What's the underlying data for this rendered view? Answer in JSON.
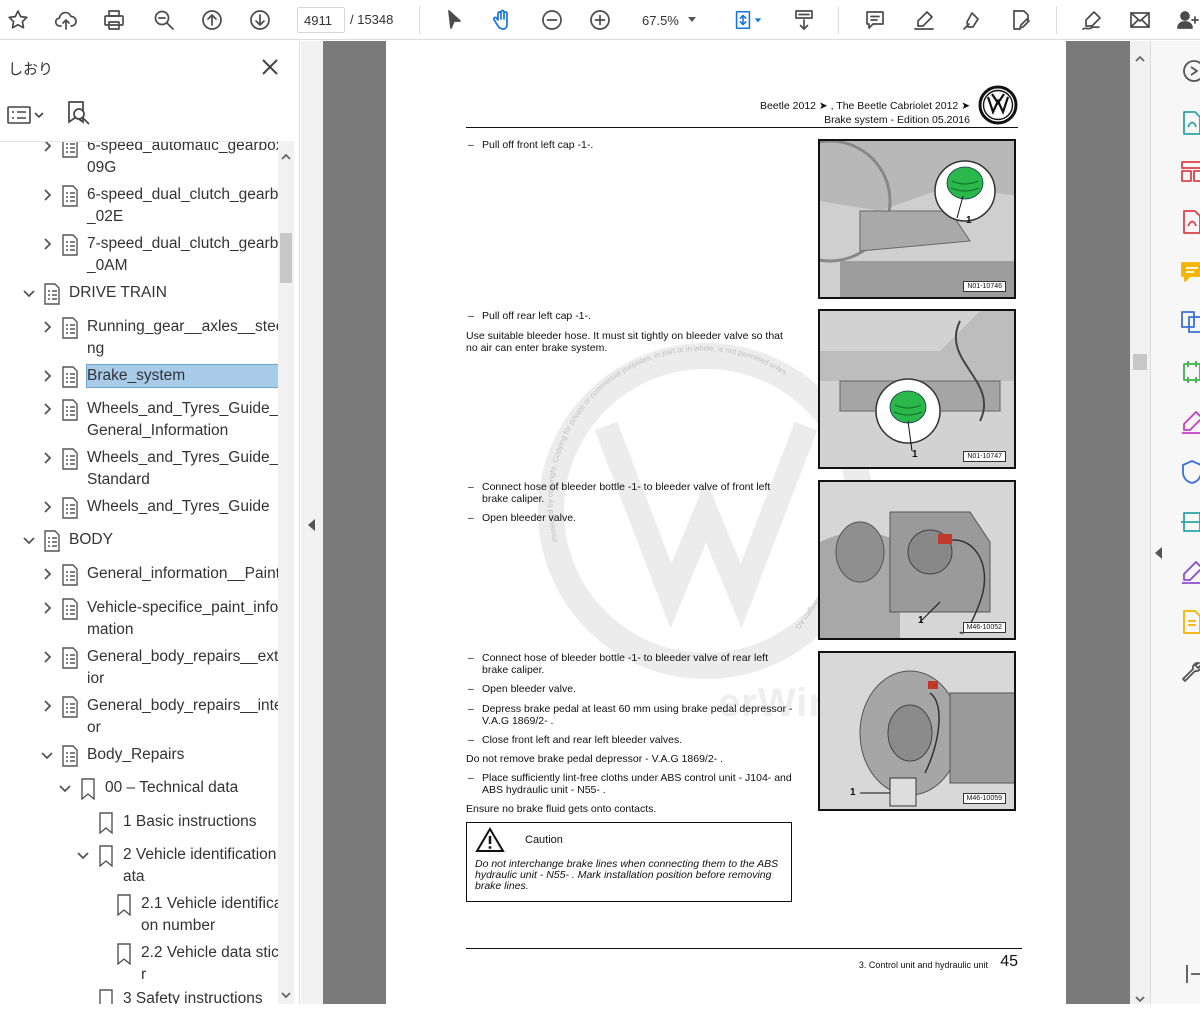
{
  "toolbar": {
    "page_current": "4911",
    "page_total": "/  15348",
    "zoom": "67.5%"
  },
  "bookmarks": {
    "title": "しおり",
    "items": [
      {
        "label": "6-speed_automatic_gearbox_09G"
      },
      {
        "label": "6-speed_dual_clutch_gearbox_02E"
      },
      {
        "label": "7-speed_dual_clutch_gearbox_0AM"
      },
      {
        "label": "DRIVE TRAIN"
      },
      {
        "label": "Running_gear__axles__steering"
      },
      {
        "label": "Brake_system"
      },
      {
        "label": "Wheels_and_Tyres_Guide_-_General_Information"
      },
      {
        "label": "Wheels_and_Tyres_Guide_-_Standard"
      },
      {
        "label": "Wheels_and_Tyres_Guide"
      },
      {
        "label": "BODY"
      },
      {
        "label": "General_information__Paint"
      },
      {
        "label": "Vehicle-specifice_paint_information"
      },
      {
        "label": "General_body_repairs__exterior"
      },
      {
        "label": "General_body_repairs__interior"
      },
      {
        "label": "Body_Repairs"
      },
      {
        "label": "00 – Technical data"
      },
      {
        "label": "1 Basic instructions"
      },
      {
        "label": "2 Vehicle identification data"
      },
      {
        "label": "2.1 Vehicle identification number"
      },
      {
        "label": "2.2 Vehicle data sticker"
      },
      {
        "label": "3 Safety instructions"
      }
    ]
  },
  "page": {
    "header_line1": "Beetle 2012 ➤ , The Beetle Cabriolet 2012 ➤",
    "header_line2": "Brake system - Edition 05.2016",
    "steps": [
      "Pull off front left cap -1-.",
      "Pull off rear left cap -1-.",
      "Use suitable bleeder hose. It must sit tightly on bleeder valve so that no air can enter brake system.",
      "Connect hose of bleeder bottle -1- to bleeder valve of front left brake caliper.",
      "Open bleeder valve.",
      "Connect hose of bleeder bottle -1- to bleeder valve of rear left brake caliper.",
      "Open bleeder valve.",
      "Depress brake pedal at least 60 mm using brake pedal depressor - V.A.G 1869/2- .",
      "Close front left and rear left bleeder valves.",
      "Do not remove brake pedal depressor - V.A.G 1869/2- .",
      "Place sufficiently lint-free cloths under ABS control unit - J104- and ABS hydraulic unit - N55- .",
      "Ensure no brake fluid gets onto contacts."
    ],
    "figures": [
      {
        "code": "N01-10746",
        "callout": "1"
      },
      {
        "code": "N01-10747",
        "callout": "1"
      },
      {
        "code": "M46-10052",
        "callout": "1"
      },
      {
        "code": "M46-10059",
        "callout": "1"
      }
    ],
    "caution_title": "Caution",
    "caution_text": "Do not interchange brake lines when connecting them to the ABS hydraulic unit - N55- . Mark installation position before removing brake lines.",
    "footer_section": "3. Control unit and hydraulic unit",
    "footer_page": "45",
    "watermark_text": "Protected by copyright. Copying for private or commercial purposes, in part or in whole, is not permitted unless authorised by Volkswagen AG. Volkswagen AG does not",
    "watermark_text2": "Copyright by Volkswagen AG",
    "watermark_brand": "erWin"
  },
  "colors": {
    "accent": "#1473e6",
    "selection": "#a7cbe8",
    "doc_background": "#7a7a7a"
  }
}
